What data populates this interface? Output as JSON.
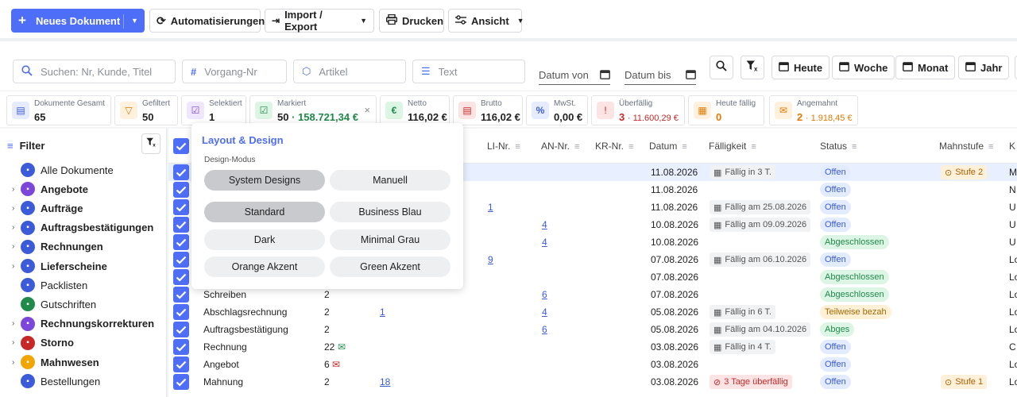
{
  "toolbar": {
    "new_doc": "Neues Dokument",
    "automations": "Automatisierungen",
    "import_export": "Import / Export",
    "print": "Drucken",
    "view": "Ansicht"
  },
  "search": {
    "query_placeholder": "Suchen: Nr, Kunde, Titel",
    "vorgang_placeholder": "Vorgang-Nr",
    "artikel_placeholder": "Artikel",
    "text_placeholder": "Text",
    "date_from": "Datum von",
    "date_to": "Datum bis",
    "today": "Heute",
    "week": "Woche",
    "month": "Monat",
    "year": "Jahr"
  },
  "stats": [
    {
      "label": "Dokumente Gesamt",
      "value": "65",
      "extra": "",
      "color": "#3b5bd9",
      "bg": "#e6ebff",
      "icon": "document-icon"
    },
    {
      "label": "Gefiltert",
      "value": "50",
      "extra": "",
      "color": "#e07a00",
      "bg": "#fff1de",
      "icon": "filter-icon"
    },
    {
      "label": "Selektiert",
      "value": "1",
      "extra": "",
      "color": "#7b46d9",
      "bg": "#efe6ff",
      "icon": "check-square-icon"
    },
    {
      "label": "Markiert",
      "value": "50",
      "extra": "· 158.721,34 €",
      "color": "#1f8a4a",
      "bg": "#ddf5e5",
      "icon": "check-square-icon"
    },
    {
      "label": "Netto",
      "value": "116,02 €",
      "extra": "",
      "color": "#1f8a4a",
      "bg": "#ddf5e5",
      "icon": "euro-icon"
    },
    {
      "label": "Brutto",
      "value": "116,02 €",
      "extra": "",
      "color": "#c62828",
      "bg": "#fde4e4",
      "icon": "receipt-icon"
    },
    {
      "label": "MwSt.",
      "value": "0,00 €",
      "extra": "",
      "color": "#3b5bd9",
      "bg": "#e6ebff",
      "icon": "percent-icon"
    },
    {
      "label": "Überfällig",
      "value": "3",
      "extra": "· 11.600,29 €",
      "color": "#c62828",
      "bg": "#fde4e4",
      "icon": "alert-icon"
    },
    {
      "label": "Heute fällig",
      "value": "0",
      "extra": "",
      "color": "#e07a00",
      "bg": "#fff1de",
      "icon": "calendar-icon"
    },
    {
      "label": "Angemahnt",
      "value": "2",
      "extra": "· 1.918,45 €",
      "color": "#e07a00",
      "bg": "#fff1de",
      "icon": "mail-icon"
    }
  ],
  "sidebar": {
    "title": "Filter",
    "items": [
      {
        "label": "Alle Dokumente",
        "bold": false,
        "arrow": false,
        "color": "#3b5bd9"
      },
      {
        "label": "Angebote",
        "bold": true,
        "arrow": true,
        "color": "#7b46d9"
      },
      {
        "label": "Aufträge",
        "bold": true,
        "arrow": true,
        "color": "#3b5bd9"
      },
      {
        "label": "Auftragsbestätigungen",
        "bold": true,
        "arrow": true,
        "color": "#3b5bd9"
      },
      {
        "label": "Rechnungen",
        "bold": true,
        "arrow": true,
        "color": "#3b5bd9"
      },
      {
        "label": "Lieferscheine",
        "bold": true,
        "arrow": true,
        "color": "#3b5bd9"
      },
      {
        "label": "Packlisten",
        "bold": false,
        "arrow": false,
        "color": "#3b5bd9"
      },
      {
        "label": "Gutschriften",
        "bold": false,
        "arrow": false,
        "color": "#1f8a4a"
      },
      {
        "label": "Rechnungskorrekturen",
        "bold": true,
        "arrow": true,
        "color": "#7b46d9"
      },
      {
        "label": "Storno",
        "bold": true,
        "arrow": true,
        "color": "#c62828"
      },
      {
        "label": "Mahnwesen",
        "bold": true,
        "arrow": true,
        "color": "#f0a500"
      },
      {
        "label": "Bestellungen",
        "bold": false,
        "arrow": false,
        "color": "#3b5bd9"
      }
    ]
  },
  "table": {
    "headers": {
      "li": "LI-Nr.",
      "an": "AN-Nr.",
      "kr": "KR-Nr.",
      "datum": "Datum",
      "faellig": "Fälligkeit",
      "status": "Status",
      "mahnstufe": "Mahnstufe",
      "last": "K"
    },
    "rows": [
      {
        "type": "",
        "num": "",
        "vorg": "",
        "li": "",
        "an": "",
        "datum": "11.08.2026",
        "due": "Fällig in 3 T.",
        "due_red": false,
        "status": "Offen",
        "mahn": "Stufe 2",
        "last": "M",
        "highlight": true
      },
      {
        "type": "",
        "num": "",
        "vorg": "",
        "li": "",
        "an": "",
        "datum": "11.08.2026",
        "due": "",
        "due_red": false,
        "status": "Offen",
        "mahn": "",
        "last": "N",
        "highlight": false
      },
      {
        "type": "",
        "num": "",
        "vorg": "",
        "li": "1",
        "an": "",
        "datum": "11.08.2026",
        "due": "Fällig am 25.08.2026",
        "due_red": false,
        "status": "Offen",
        "mahn": "",
        "last": "U",
        "highlight": false
      },
      {
        "type": "",
        "num": "",
        "vorg": "",
        "li": "",
        "an": "4",
        "datum": "10.08.2026",
        "due": "Fällig am 09.09.2026",
        "due_red": false,
        "status": "Offen",
        "mahn": "",
        "last": "U",
        "highlight": false
      },
      {
        "type": "",
        "num": "",
        "vorg": "",
        "li": "",
        "an": "4",
        "datum": "10.08.2026",
        "due": "",
        "due_red": false,
        "status": "Abgeschlossen",
        "mahn": "",
        "last": "U",
        "highlight": false
      },
      {
        "type": "",
        "num": "",
        "vorg": "",
        "li": "9",
        "an": "",
        "datum": "07.08.2026",
        "due": "Fällig am 06.10.2026",
        "due_red": false,
        "status": "Offen",
        "mahn": "",
        "last": "Lo",
        "highlight": false
      },
      {
        "type": "",
        "num": "",
        "vorg": "",
        "li": "",
        "an": "",
        "datum": "07.08.2026",
        "due": "",
        "due_red": false,
        "status": "Abgeschlossen",
        "mahn": "",
        "last": "Lo",
        "highlight": false
      },
      {
        "type": "Schreiben",
        "num": "2",
        "vorg": "",
        "li": "",
        "an": "6",
        "datum": "07.08.2026",
        "due": "",
        "due_red": false,
        "status": "Abgeschlossen",
        "mahn": "",
        "last": "Lo",
        "highlight": false
      },
      {
        "type": "Abschlagsrechnung",
        "num": "2",
        "vorg": "1",
        "li": "",
        "an": "4",
        "datum": "05.08.2026",
        "due": "Fällig in 6 T.",
        "due_red": false,
        "status": "Teilweise bezah",
        "mahn": "",
        "last": "Lo",
        "highlight": false
      },
      {
        "type": "Auftragsbestätigung",
        "num": "2",
        "vorg": "",
        "li": "",
        "an": "6",
        "datum": "05.08.2026",
        "due": "Fällig am 04.10.2026",
        "due_red": false,
        "status": "Abges",
        "mahn": "",
        "last": "Lo",
        "highlight": false
      },
      {
        "type": "Rechnung",
        "num": "22",
        "vorg": "",
        "li": "",
        "an": "",
        "datum": "03.08.2026",
        "due": "Fällig in 4 T.",
        "due_red": false,
        "status": "Offen",
        "mahn": "",
        "last": "C",
        "highlight": false
      },
      {
        "type": "Angebot",
        "num": "6",
        "vorg": "",
        "li": "",
        "an": "",
        "datum": "03.08.2026",
        "due": "",
        "due_red": false,
        "status": "Offen",
        "mahn": "",
        "last": "Lo",
        "highlight": false
      },
      {
        "type": "Mahnung",
        "num": "2",
        "vorg": "18",
        "li": "",
        "an": "",
        "datum": "03.08.2026",
        "due": "3 Tage überfällig",
        "due_red": true,
        "status": "Offen",
        "mahn": "Stufe 1",
        "last": "Lo",
        "highlight": false
      }
    ]
  },
  "popup": {
    "title": "Layout & Design",
    "subtitle": "Design-Modus",
    "mode_system": "System Designs",
    "mode_manual": "Manuell",
    "themes": [
      "Standard",
      "Business Blau",
      "Dark",
      "Minimal Grau",
      "Orange Akzent",
      "Green Akzent"
    ]
  }
}
